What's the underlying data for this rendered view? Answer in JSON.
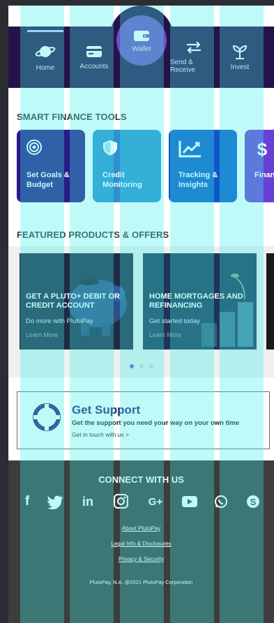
{
  "nav": {
    "items": [
      {
        "label": "Home"
      },
      {
        "label": "Accounts"
      },
      {
        "label": "Wallet"
      },
      {
        "label": "Send & Receive"
      },
      {
        "label": "Invest"
      }
    ]
  },
  "tools": {
    "title": "SMART FINANCE TOOLS",
    "cards": [
      {
        "label": "Set Goals & Budget",
        "icon": "target-icon"
      },
      {
        "label": "Credit Monitoring",
        "icon": "shield-icon"
      },
      {
        "label": "Tracking & Insights",
        "icon": "trend-chart-icon"
      },
      {
        "label": "Finan Guida",
        "icon": "dollar-icon"
      }
    ]
  },
  "offers": {
    "title": "FEATURED PRODUCTS & OFFERS",
    "cards": [
      {
        "title": "GET A PLUTO+ DEBIT OR CREDIT ACCOUNT",
        "subtitle": "Do more with PlutoPay",
        "link": "Learn More"
      },
      {
        "title": "HOME MORTGAGES AND REFINANCING",
        "subtitle": "Get started today",
        "link": "Learn More"
      }
    ],
    "active_page": 1,
    "page_count": 3
  },
  "support": {
    "title": "Get Support",
    "description": "Get the support you need your way on your own time",
    "link": "Get in touch with us >"
  },
  "footer": {
    "connect_title": "CONNECT WITH US",
    "social": [
      "f",
      "twitter",
      "in",
      "instagram",
      "G+",
      "youtube",
      "whatsapp",
      "skype"
    ],
    "links": [
      "About PlutoPay",
      "Legal Info & Disclosures",
      "Privacy & Security"
    ],
    "copyright": "PlutoPay, N.A.   @2021 PlutoPay Corporation"
  },
  "colors": {
    "nav_bg": "#26124b",
    "wallet_accent": "#6d4fc2",
    "support_title": "#1e2a7a",
    "footer_bg": "#3d3d3d"
  }
}
